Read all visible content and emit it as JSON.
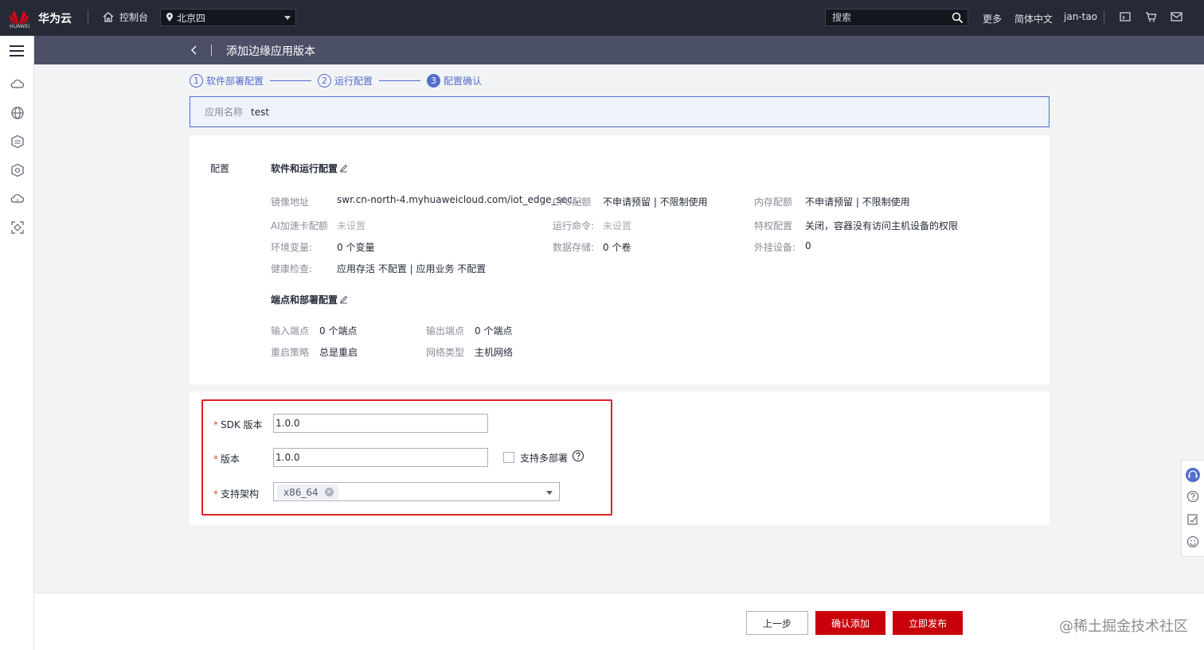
{
  "topbar": {
    "brand": "华为云",
    "logo_text": "HUAWEI",
    "console": "控制台",
    "region": "北京四",
    "search_placeholder": "搜索",
    "more": "更多",
    "language": "简体中文",
    "user": "jan-tao"
  },
  "titlebar": {
    "title": "添加边缘应用版本"
  },
  "steps": [
    {
      "num": "1",
      "label": "软件部署配置"
    },
    {
      "num": "2",
      "label": "运行配置"
    },
    {
      "num": "3",
      "label": "配置确认"
    }
  ],
  "app": {
    "name_label": "应用名称",
    "name_value": "test"
  },
  "config": {
    "section_label": "配置",
    "software_title": "软件和运行配置",
    "image_label": "镜像地址",
    "image_value": "swr.cn-north-4.myhuaweicloud.com/iot_edge_sec...",
    "cpu_label": "CPU配额",
    "cpu_value": "不申请预留 | 不限制使用",
    "mem_label": "内存配额",
    "mem_value": "不申请预留 | 不限制使用",
    "ai_label": "AI加速卡配额",
    "ai_value": "未设置",
    "cmd_label": "运行命令:",
    "cmd_value": "未设置",
    "priv_label": "特权配置",
    "priv_value": "关闭，容器没有访问主机设备的权限",
    "env_label": "环境变量:",
    "env_value": "0 个变量",
    "storage_label": "数据存储:",
    "storage_value": "0 个卷",
    "device_label": "外挂设备:",
    "device_value": "0",
    "health_label": "健康检查:",
    "health_value": "应用存活 不配置 | 应用业务 不配置",
    "endpoint_title": "端点和部署配置",
    "input_label": "输入端点",
    "input_value": "0 个端点",
    "output_label": "输出端点",
    "output_value": "0 个端点",
    "restart_label": "重启策略",
    "restart_value": "总是重启",
    "network_label": "网络类型",
    "network_value": "主机网络"
  },
  "form": {
    "sdk_label": "SDK 版本",
    "sdk_value": "1.0.0",
    "version_label": "版本",
    "version_value": "1.0.0",
    "multi_label": "支持多部署",
    "arch_label": "支持架构",
    "arch_tag": "x86_64"
  },
  "footer": {
    "prev": "上一步",
    "confirm": "确认添加",
    "publish": "立即发布",
    "watermark": "@稀土掘金技术社区"
  },
  "colors": {
    "accent": "#526ecc",
    "brand_red": "#c7000b",
    "highlight_box": "#e02020"
  }
}
